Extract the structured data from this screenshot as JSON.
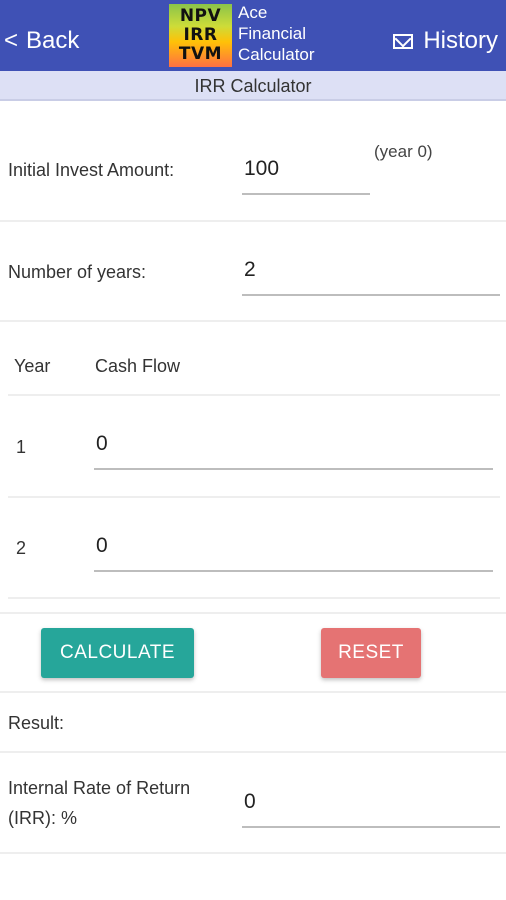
{
  "header": {
    "back_label": "Back",
    "back_chevron": "<",
    "logo_lines": [
      "NPV",
      "IRR",
      "TVM"
    ],
    "app_title_lines": [
      "Ace",
      "Financial",
      "Calculator"
    ],
    "history_label": "History",
    "bar_color": "#3f51b5"
  },
  "subheader": {
    "title": "IRR Calculator"
  },
  "form": {
    "initial_label": "Initial Invest Amount:",
    "initial_value": "100",
    "initial_hint": "(year 0)",
    "years_label": "Number of years:",
    "years_value": "2"
  },
  "cashflow": {
    "col_year": "Year",
    "col_cashflow": "Cash Flow",
    "rows": [
      {
        "year": "1",
        "value": "0"
      },
      {
        "year": "2",
        "value": "0"
      }
    ]
  },
  "actions": {
    "calculate_label": "CALCULATE",
    "reset_label": "RESET",
    "calculate_color": "#26a69a",
    "reset_color": "#e57373"
  },
  "result": {
    "heading": "Result:",
    "irr_label_line1": "Internal Rate of Return",
    "irr_label_line2": "(IRR): %",
    "irr_value": "0"
  }
}
